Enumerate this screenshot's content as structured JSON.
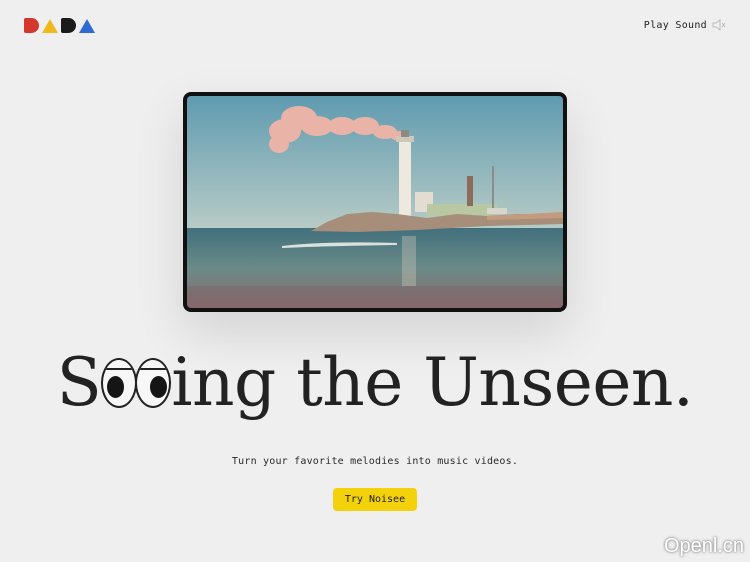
{
  "brand": {
    "logo_text": "DADA",
    "colors": {
      "d1": "#d4382c",
      "a1": "#f0b81a",
      "d2": "#1b1b1b",
      "a2": "#2f6bd3"
    }
  },
  "header": {
    "play_sound_label": "Play Sound",
    "play_sound_icon": "speaker-muted-icon"
  },
  "hero": {
    "headline_before_eyes": "S",
    "headline_after_eyes": "ing the Unseen.",
    "subtitle": "Turn your favorite melodies into music videos.",
    "cta_label": "Try Noisee",
    "cta_color": "#f3d20c"
  },
  "watermark": "Openl.cn"
}
